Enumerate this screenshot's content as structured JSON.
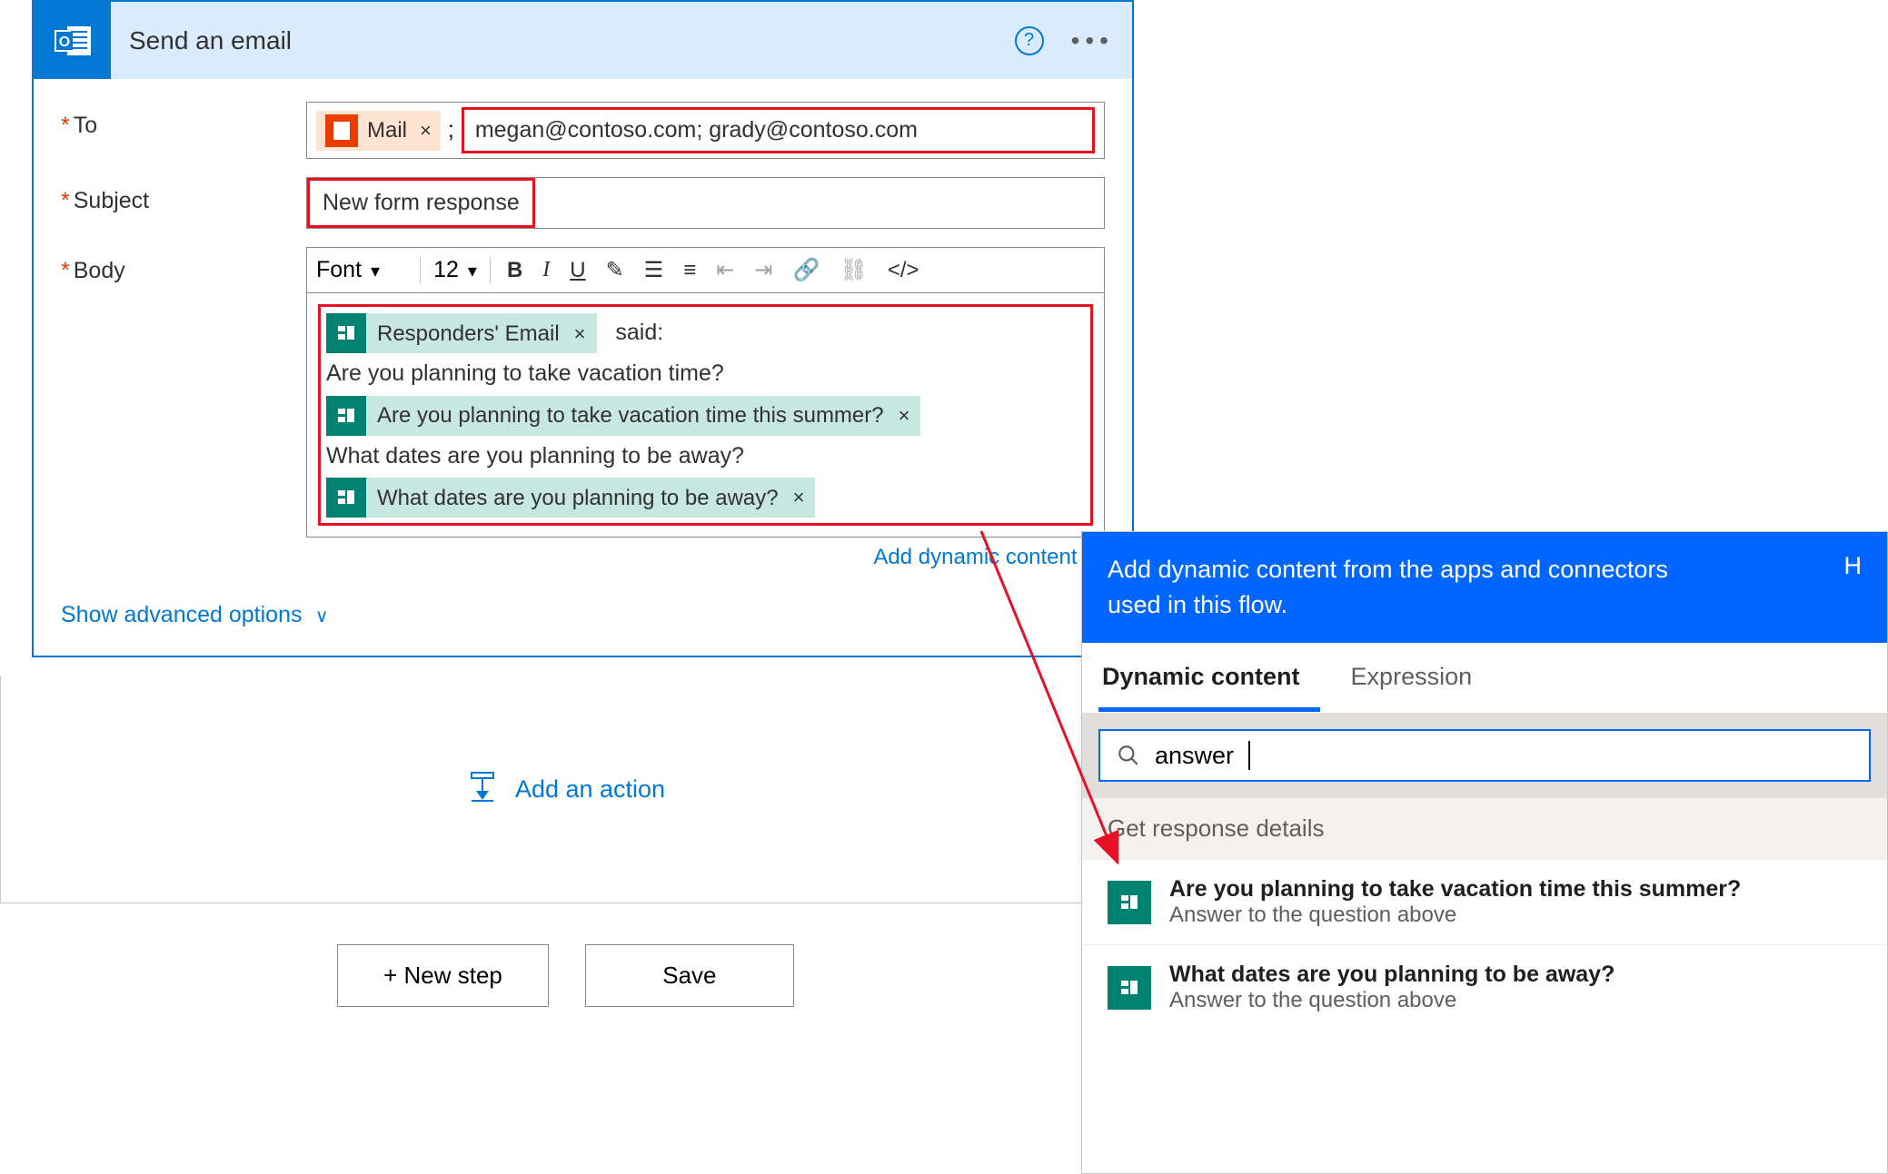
{
  "card": {
    "title": "Send an email",
    "fields": {
      "to_label": "To",
      "subject_label": "Subject",
      "body_label": "Body"
    },
    "to": {
      "token_label": "Mail",
      "value": "megan@contoso.com; grady@contoso.com"
    },
    "subject": {
      "value": "New form response"
    },
    "body": {
      "font_label": "Font",
      "font_size": "12",
      "token1": "Responders' Email",
      "text_after_token1": "said:",
      "line2": "Are you planning to take vacation time?",
      "token2": "Are you planning to take vacation time this summer?",
      "line3": "What dates are you planning to be away?",
      "token3": "What dates are you planning to be away?"
    },
    "add_dynamic_label": "Add dynamic content",
    "advanced_label": "Show advanced options"
  },
  "add_action_label": "Add an action",
  "buttons": {
    "new_step": "+ New step",
    "save": "Save"
  },
  "dc": {
    "header_text": "Add dynamic content from the apps and connectors used in this flow.",
    "hide_label": "H",
    "tab_dynamic": "Dynamic content",
    "tab_expression": "Expression",
    "search_value": "answer",
    "section_title": "Get response details",
    "items": [
      {
        "title": "Are you planning to take vacation time this summer?",
        "sub": "Answer to the question above"
      },
      {
        "title": "What dates are you planning to be away?",
        "sub": "Answer to the question above"
      }
    ]
  }
}
